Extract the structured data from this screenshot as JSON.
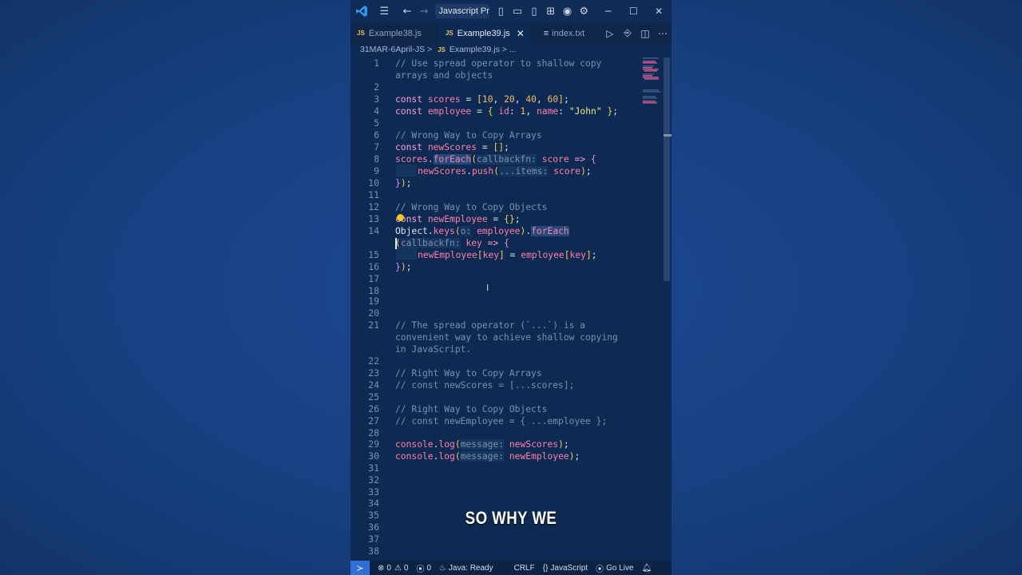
{
  "titlebar": {
    "title": "Javascript Prac"
  },
  "tabs": [
    {
      "icon": "JS",
      "label": "Example38.js",
      "active": false
    },
    {
      "icon": "JS",
      "label": "Example39.js",
      "active": true
    },
    {
      "icon": "≡",
      "label": "index.txt",
      "active": false
    }
  ],
  "breadcrumb": {
    "folder": "31MAR-6April-JS",
    "sep1": ">",
    "file_icon": "JS",
    "file": "Example39.js",
    "sep2": ">",
    "symbol": "..."
  },
  "line_numbers": [
    "1",
    "2",
    "3",
    "4",
    "5",
    "6",
    "7",
    "8",
    "9",
    "10",
    "11",
    "12",
    "13",
    "14",
    "15",
    "16",
    "17",
    "18",
    "19",
    "20",
    "21",
    "22",
    "23",
    "24",
    "25",
    "26",
    "27",
    "28",
    "29",
    "30",
    "31",
    "32",
    "33",
    "34",
    "35",
    "36",
    "37",
    "38"
  ],
  "code": {
    "l1a": "// Use spread operator to shallow copy",
    "l1b": "arrays and objects",
    "l3": [
      "const",
      "scores",
      "=",
      "[",
      "10",
      ", ",
      "20",
      ", ",
      "40",
      ", ",
      "60",
      "]",
      ";"
    ],
    "l4": [
      "const",
      "employee",
      "=",
      "{",
      "id",
      ":",
      "1",
      ", ",
      "name",
      ":",
      "\"John\"",
      "}",
      ";"
    ],
    "l6": "// Wrong Way to Copy Arrays",
    "l7": [
      "const",
      "newScores",
      "=",
      "[]",
      ";"
    ],
    "l8": [
      "scores",
      ".",
      "forEach",
      "(",
      "callbackfn:",
      "score",
      "=>",
      "{"
    ],
    "l9": [
      "newScores",
      ".",
      "push",
      "(",
      "...items:",
      "score",
      ")",
      ";"
    ],
    "l10": [
      "}",
      ")",
      ";"
    ],
    "l12": "// Wrong Way to Copy Objects",
    "l13": [
      "const",
      "newEmployee",
      "=",
      "{}",
      ";"
    ],
    "l14a": [
      "Object",
      ".",
      "keys",
      "(",
      "o:",
      "employee",
      ")",
      ".",
      "forEach"
    ],
    "l14b": [
      "(",
      "callbackfn:",
      "key",
      "=>",
      "{"
    ],
    "l15": [
      "newEmployee",
      "[",
      "key",
      "]",
      "=",
      "employee",
      "[",
      "key",
      "]",
      ";"
    ],
    "l16": [
      "}",
      ")",
      ";"
    ],
    "l21a": "// The spread operator (`...`) is a",
    "l21b": "convenient way to achieve shallow copying",
    "l21c": "in JavaScript.",
    "l23": "// Right Way to Copy Arrays",
    "l24": "// const newScores = [...scores];",
    "l26": "// Right Way to Copy Objects",
    "l27": "// const newEmployee = { ...employee };",
    "l29": [
      "console",
      ".",
      "log",
      "(",
      "message:",
      "newScores",
      ")",
      ";"
    ],
    "l30": [
      "console",
      ".",
      "log",
      "(",
      "message:",
      "newEmployee",
      ")",
      ";"
    ]
  },
  "caption": "SO WHY WE",
  "statusbar": {
    "errors": "0",
    "warnings": "0",
    "ports": "0",
    "java": "Java: Ready",
    "eol": "CRLF",
    "language": "JavaScript",
    "golive": "Go Live"
  }
}
